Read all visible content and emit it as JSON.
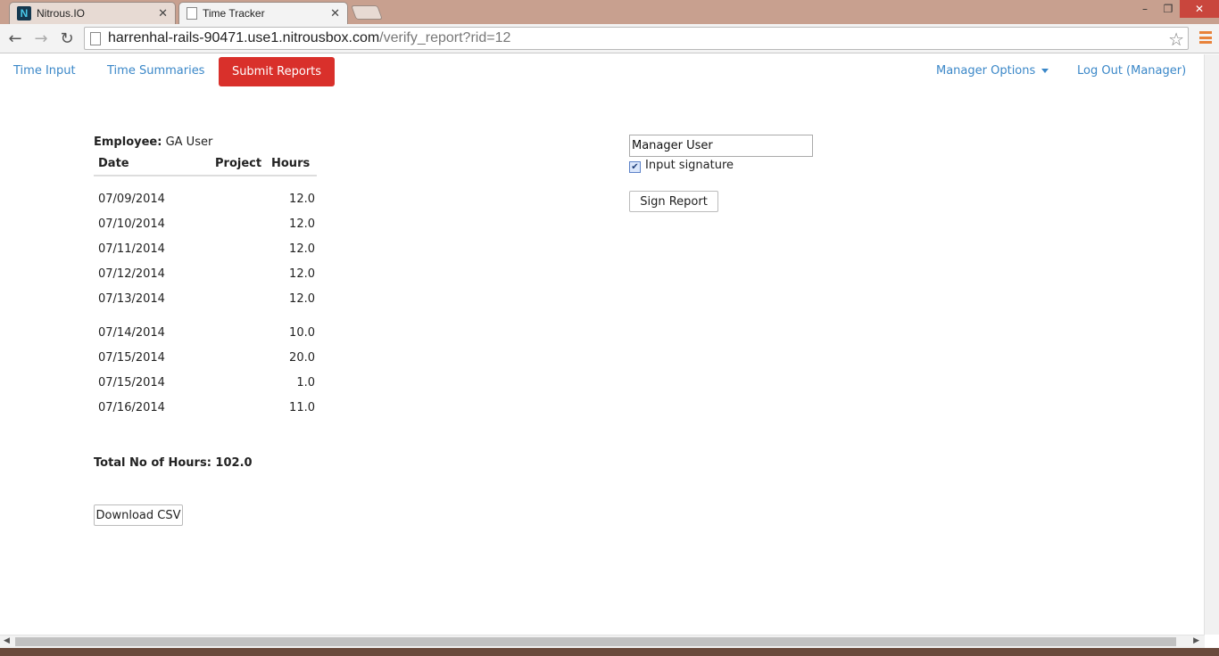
{
  "browser": {
    "tabs": [
      {
        "title": "Nitrous.IO",
        "favicon": "N",
        "active": false
      },
      {
        "title": "Time Tracker",
        "active": true
      }
    ],
    "url_host": "harrenhal-rails-90471.use1.nitrousbox.com",
    "url_path": "/verify_report?rid=12",
    "tab_close": "✕",
    "win_min": "–",
    "win_restore": "❐",
    "win_close": "✕",
    "back": "←",
    "forward": "→",
    "reload": "↻",
    "star": "☆"
  },
  "nav": {
    "time_input": "Time Input",
    "time_summaries": "Time Summaries",
    "submit_reports": "Submit Reports",
    "manager_options": "Manager Options",
    "logout": "Log Out (Manager)"
  },
  "report": {
    "employee_label": "Employee:",
    "employee_name": "GA User",
    "columns": {
      "date": "Date",
      "project": "Project",
      "hours": "Hours"
    },
    "rows": [
      {
        "date": "07/09/2014",
        "project": "",
        "hours": "12.0"
      },
      {
        "date": "07/10/2014",
        "project": "",
        "hours": "12.0"
      },
      {
        "date": "07/11/2014",
        "project": "",
        "hours": "12.0"
      },
      {
        "date": "07/12/2014",
        "project": "",
        "hours": "12.0"
      },
      {
        "date": "07/13/2014",
        "project": "",
        "hours": "12.0"
      },
      {
        "date": "07/14/2014",
        "project": "",
        "hours": "10.0"
      },
      {
        "date": "07/15/2014",
        "project": "",
        "hours": "20.0"
      },
      {
        "date": "07/15/2014",
        "project": "",
        "hours": "1.0"
      },
      {
        "date": "07/16/2014",
        "project": "",
        "hours": "11.0"
      }
    ],
    "total": "Total No of Hours: 102.0",
    "download_csv": "Download CSV"
  },
  "signature": {
    "input_value": "Manager User",
    "checkbox_checked": true,
    "checkbox_label": "Input signature",
    "sign_button": "Sign Report"
  },
  "colors": {
    "accent_red": "#d9302b",
    "link_blue": "#3a87c8"
  }
}
